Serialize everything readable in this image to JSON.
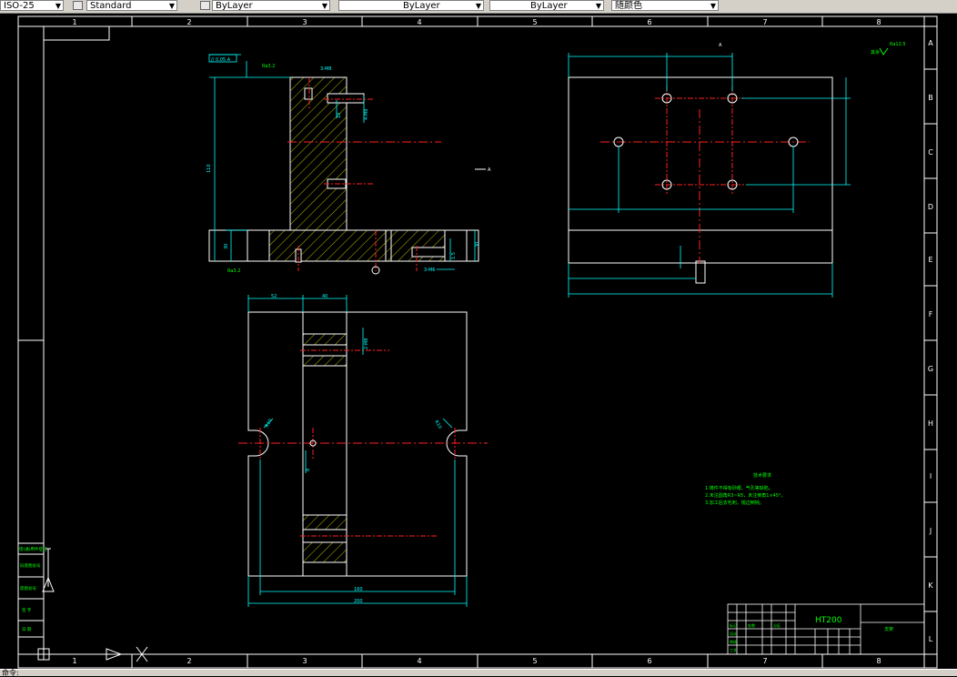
{
  "toolbar": {
    "dim_style": "ISO-25",
    "text_style": "Standard",
    "color": "ByLayer",
    "linetype": "ByLayer",
    "lineweight": "ByLayer",
    "plot_style": "随颜色"
  },
  "frame": {
    "columns": [
      "1",
      "2",
      "3",
      "4",
      "5",
      "6",
      "7",
      "8"
    ],
    "rows": [
      "A",
      "B",
      "C",
      "D",
      "E",
      "F",
      "G",
      "H",
      "I",
      "J",
      "K",
      "L"
    ]
  },
  "top_view": {
    "section_mark": "A",
    "flatness": "// 0.05 A",
    "roughness_top": "Ra3.2",
    "roughness_base": "Ra3.2",
    "dims": {
      "height": "110",
      "base": "30",
      "right_base": "30",
      "hole_top": "3-M8",
      "hole_side": "4-M8",
      "hole_base": "3-M6",
      "slot": "10",
      "base_inner": "1.5"
    }
  },
  "right_view": {
    "section_mark": "A",
    "dims": {
      "d1": "60",
      "d2": "50",
      "d3": "40",
      "d4": "130",
      "d5": "115",
      "d6": "140",
      "d7": "30",
      "d8": "70",
      "d9": "4"
    }
  },
  "front_view": {
    "dims": {
      "w1": "52",
      "w2": "40",
      "bottom_inner": "160",
      "bottom_outer": "200",
      "r_left": "R10",
      "r_right": "R10",
      "hole": "2-M8",
      "depth": "8"
    }
  },
  "notes": {
    "title": "技术要求",
    "lines": [
      "1.铸件不得有砂眼、气孔等缺陷。",
      "2.未注圆角R3~R5，未注倒角1×45°。",
      "3.加工后去毛刺，锐边倒钝。"
    ]
  },
  "title_block": {
    "material": "HT200",
    "part_name": "支架",
    "rows": [
      "标记",
      "处数",
      "分区",
      "设计",
      "审核",
      "工艺"
    ]
  },
  "left_panel": {
    "items": [
      "借(通)用件登记",
      "旧底图总号",
      "底图总号",
      "签 字",
      "日 期"
    ]
  },
  "status": {
    "prompt": "命令:"
  }
}
